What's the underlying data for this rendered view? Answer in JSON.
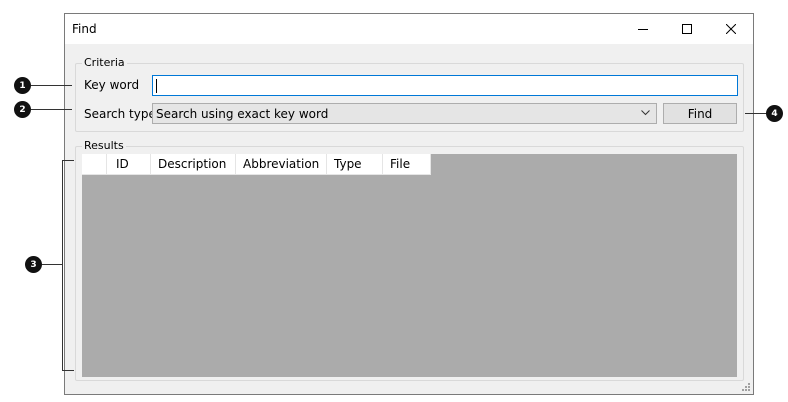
{
  "window": {
    "title": "Find"
  },
  "criteria": {
    "legend": "Criteria",
    "keyword_label": "Key word",
    "keyword_value": "",
    "search_type_label": "Search type",
    "search_type_value": "Search using exact key word",
    "find_button": "Find"
  },
  "results": {
    "legend": "Results",
    "columns": [
      "",
      "ID",
      "Description",
      "Abbreviation",
      "Type",
      "File"
    ],
    "rows": []
  },
  "callouts": [
    "1",
    "2",
    "3",
    "4"
  ],
  "colors": {
    "window_bg": "#f0f0f0",
    "grid_bg": "#ababab",
    "focus_border": "#0078d7",
    "callout_bg": "#111111"
  },
  "icons": {
    "minimize": "minimize-icon",
    "maximize": "maximize-icon",
    "close": "close-icon",
    "dropdown": "chevron-down-icon",
    "resize": "resize-grip-icon"
  }
}
